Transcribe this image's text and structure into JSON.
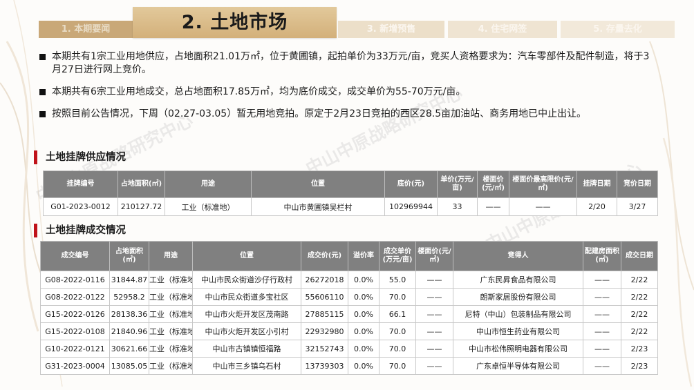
{
  "tabs": [
    {
      "label": "1. 本期要闻"
    },
    {
      "label": "2. 土地市场"
    },
    {
      "label": "3. 新增预售"
    },
    {
      "label": "4. 住宅网签"
    },
    {
      "label": "5. 存量去化"
    }
  ],
  "bullets": [
    "本期共有1宗工业用地供应，占地面积21.01万㎡，位于黄圃镇，起拍单价为33万元/亩，竞买人资格要求为：汽车零部件及配件制造，将于3月27日进行网上竞价。",
    "本期共有6宗工业用地成交，总占地面积17.85万㎡，均为底价成交，成交单价为55-70万元/亩。",
    "按照目前公告情况，下周（02.27-03.05）暂无用地竞拍。原定于2月23日竞拍的西区28.5亩加油站、商务用地已中止出让。"
  ],
  "watermark": "中山中原战略研究中心",
  "supply": {
    "title": "土地挂牌供应情况",
    "headers": [
      "挂牌编号",
      "占地面积(㎡)",
      "用途",
      "位置",
      "底价(元)",
      "单价(万元/亩)",
      "楼面价(元/㎡)",
      "楼面价最高限价(元/㎡)",
      "挂牌日期",
      "竞价日期"
    ],
    "rows": [
      [
        "G01-2023-0012",
        "210127.72",
        "工业（标准地）",
        "中山市黄圃镇吴栏村",
        "102969944",
        "33",
        "——",
        "——",
        "2/20",
        "3/27"
      ]
    ]
  },
  "deals": {
    "title": "土地挂牌成交情况",
    "headers": [
      "成交编号",
      "占地面积(㎡)",
      "用途",
      "位置",
      "成交价(元)",
      "溢价率",
      "成交单价(万元/亩)",
      "楼面价(元/㎡)",
      "竞得人",
      "配建房面积(㎡)",
      "成交日期"
    ],
    "rows": [
      [
        "G08-2022-0116",
        "31844.87",
        "工业（标准地）",
        "中山市民众街道沙仔行政村",
        "26272018",
        "0.0%",
        "55.0",
        "——",
        "广东民昇食品有限公司",
        "——",
        "2/22"
      ],
      [
        "G08-2022-0122",
        "52958.2",
        "工业（标准地）",
        "中山市民众街道多宝社区",
        "55606110",
        "0.0%",
        "70.0",
        "——",
        "朗斯家居股份有限公司",
        "——",
        "2/22"
      ],
      [
        "G15-2022-0126",
        "28138.36",
        "工业（标准地）",
        "中山市火炬开发区茂南路",
        "27885115",
        "0.0%",
        "66.1",
        "——",
        "尼特（中山）包装制品有限公司",
        "——",
        "2/22"
      ],
      [
        "G15-2022-0108",
        "21840.96",
        "工业（标准地）",
        "中山市火炬开发区小引村",
        "22932980",
        "0.0%",
        "70.0",
        "——",
        "中山市恒生药业有限公司",
        "——",
        "2/22"
      ],
      [
        "G10-2022-0121",
        "30621.66",
        "工业（标准地）",
        "中山市古镇镇恒福路",
        "32152743",
        "0.0%",
        "70.0",
        "——",
        "中山市松伟照明电器有限公司",
        "——",
        "2/23"
      ],
      [
        "G31-2023-0004",
        "13085.05",
        "工业（标准地）",
        "中山市三乡镇乌石村",
        "13739303",
        "0.0%",
        "70.0",
        "——",
        "广东卓恒半导体有限公司",
        "——",
        "2/23"
      ]
    ]
  }
}
